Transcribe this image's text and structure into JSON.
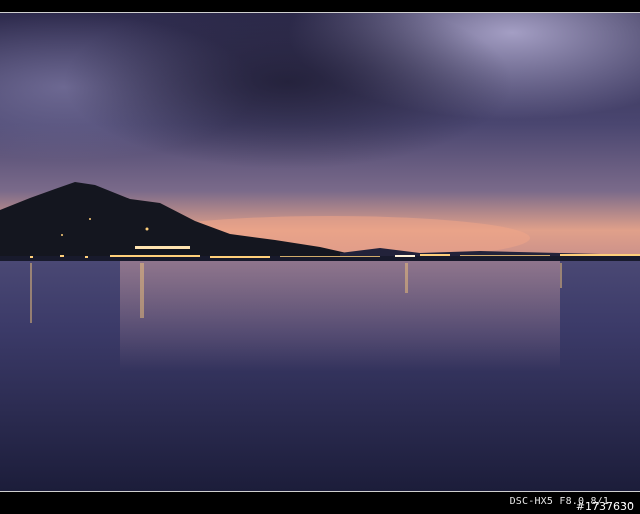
{
  "photo": {
    "subject": "dusk-seascape",
    "colors": {
      "sky_dark": "#2e2b4d",
      "sky_mid": "#4a4670",
      "sunset_glow": "#e89a82",
      "mountain": "#14161f",
      "water_dark": "#1c1d3a",
      "water_mid": "#3b3a68",
      "city_lights": "#ffcf7a"
    }
  },
  "caption": {
    "exif": "DSC-HX5 F8.0 8/1 ...",
    "photo_number": "#1737630"
  }
}
